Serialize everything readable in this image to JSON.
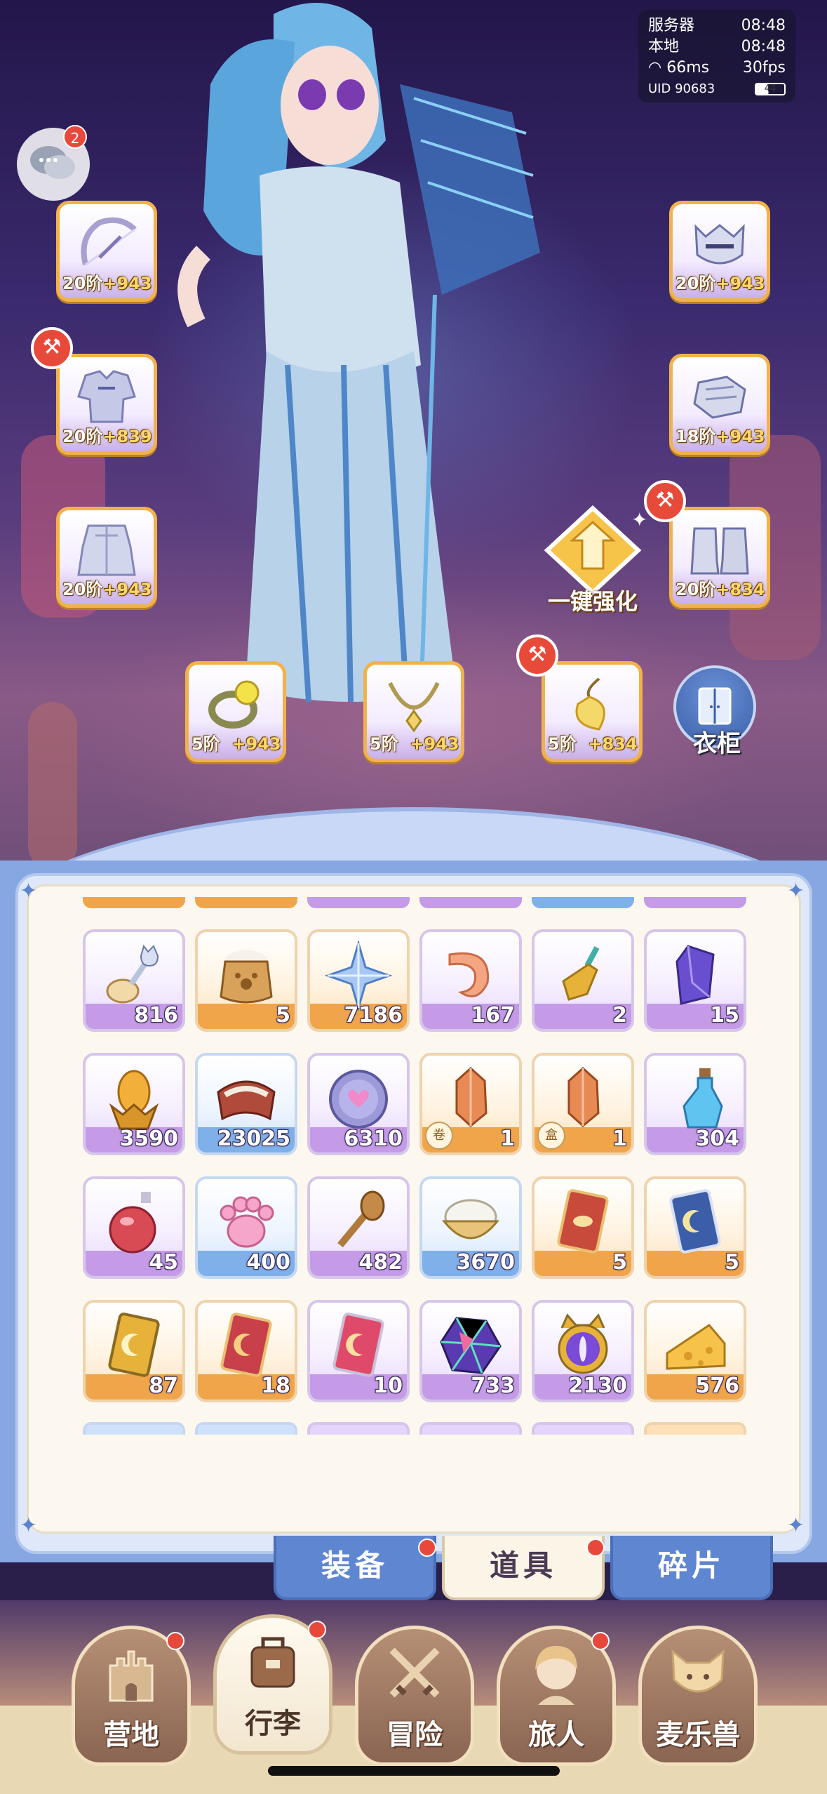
{
  "hud": {
    "server_label": "服务器",
    "server_time": "08:48",
    "local_label": "本地",
    "local_time": "08:48",
    "ping": "66ms",
    "fps": "30fps",
    "uid": "UID 90683",
    "battery": "44"
  },
  "chat": {
    "badge": "2"
  },
  "equipment": {
    "left": [
      {
        "tier": "20阶",
        "bonus": "+943"
      },
      {
        "tier": "20阶",
        "bonus": "+839"
      },
      {
        "tier": "20阶",
        "bonus": "+943"
      }
    ],
    "right": [
      {
        "tier": "20阶",
        "bonus": "+943"
      },
      {
        "tier": "18阶",
        "bonus": "+943"
      },
      {
        "tier": "20阶",
        "bonus": "+834"
      }
    ],
    "accessories": [
      {
        "tier": "5阶",
        "bonus": "+943"
      },
      {
        "tier": "5阶",
        "bonus": "+943"
      },
      {
        "tier": "5阶",
        "bonus": "+834"
      }
    ]
  },
  "enhance": {
    "label": "一键强化"
  },
  "wardrobe": {
    "label": "衣柜"
  },
  "inventory": {
    "rows": [
      [
        {
          "icon": "cat-spoon-icon",
          "count": "816",
          "rarity": "purple"
        },
        {
          "icon": "paw-flour-sack-icon",
          "count": "5",
          "rarity": "orange"
        },
        {
          "icon": "ice-star-crystal-icon",
          "count": "7186",
          "rarity": "orange"
        },
        {
          "icon": "shrimp-icon",
          "count": "167",
          "rarity": "purple"
        },
        {
          "icon": "golden-trowel-icon",
          "count": "2",
          "rarity": "purple"
        },
        {
          "icon": "purple-gem-icon",
          "count": "15",
          "rarity": "purple"
        }
      ],
      [
        {
          "icon": "amber-egg-icon",
          "count": "3590",
          "rarity": "purple"
        },
        {
          "icon": "red-saddle-icon",
          "count": "23025",
          "rarity": "blue"
        },
        {
          "icon": "heart-coin-icon",
          "count": "6310",
          "rarity": "purple"
        },
        {
          "icon": "copper-ore-icon",
          "count": "1",
          "rarity": "orange",
          "mark": "卷"
        },
        {
          "icon": "copper-ore-icon",
          "count": "1",
          "rarity": "orange",
          "mark": "盒"
        },
        {
          "icon": "blue-potion-icon",
          "count": "304",
          "rarity": "purple"
        }
      ],
      [
        {
          "icon": "red-potion-icon",
          "count": "45",
          "rarity": "purple"
        },
        {
          "icon": "pink-paw-icon",
          "count": "400",
          "rarity": "blue"
        },
        {
          "icon": "wooden-spoon-icon",
          "count": "482",
          "rarity": "purple"
        },
        {
          "icon": "rice-bowl-icon",
          "count": "3670",
          "rarity": "blue"
        },
        {
          "icon": "red-eye-card-icon",
          "count": "5",
          "rarity": "orange"
        },
        {
          "icon": "blue-moon-card-icon",
          "count": "5",
          "rarity": "orange"
        }
      ],
      [
        {
          "icon": "gold-moon-card-icon",
          "count": "87",
          "rarity": "orange"
        },
        {
          "icon": "red-moon-card-icon",
          "count": "18",
          "rarity": "orange"
        },
        {
          "icon": "pink-moon-card-icon",
          "count": "10",
          "rarity": "purple"
        },
        {
          "icon": "rainbow-crystal-icon",
          "count": "733",
          "rarity": "purple"
        },
        {
          "icon": "cat-eye-orb-icon",
          "count": "2130",
          "rarity": "purple"
        },
        {
          "icon": "cheese-icon",
          "count": "576",
          "rarity": "orange"
        }
      ]
    ]
  },
  "tabs": [
    {
      "label": "装备",
      "active": false,
      "dot": true
    },
    {
      "label": "道具",
      "active": true,
      "dot": true
    },
    {
      "label": "碎片",
      "active": false,
      "dot": false
    }
  ],
  "nav": [
    {
      "label": "营地",
      "icon": "castle-icon",
      "dot": true
    },
    {
      "label": "行李",
      "icon": "backpack-icon",
      "dot": true,
      "active": true
    },
    {
      "label": "冒险",
      "icon": "crossed-swords-icon",
      "dot": false
    },
    {
      "label": "旅人",
      "icon": "traveler-portrait-icon",
      "dot": true
    },
    {
      "label": "麦乐兽",
      "icon": "cat-face-icon",
      "dot": false
    }
  ],
  "colors": {
    "accent_orange": "#f2b24a",
    "tab_blue": "#5f86d0",
    "badge_red": "#e8483c",
    "paper": "#fcf8ef"
  }
}
